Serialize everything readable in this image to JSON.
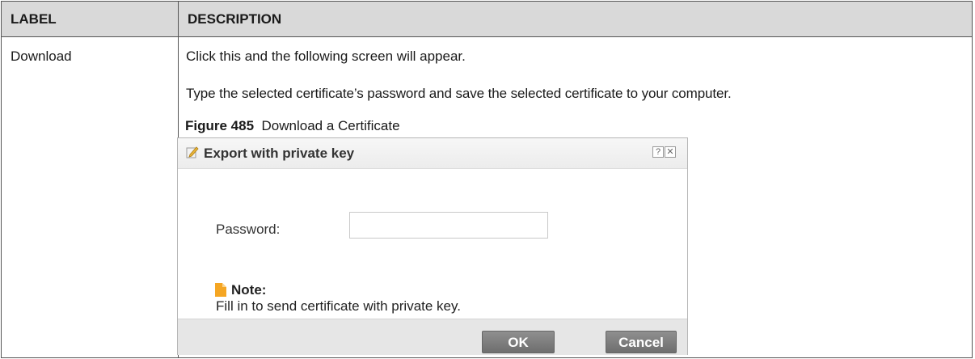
{
  "table": {
    "headers": {
      "label": "LABEL",
      "description": "DESCRIPTION"
    },
    "row": {
      "label": "Download",
      "line1": "Click this and the following screen will appear.",
      "line2": "Type the selected certificate’s password and save the selected certificate to your computer."
    }
  },
  "figure": {
    "number": "Figure 485",
    "caption": "Download a Certificate"
  },
  "dialog": {
    "title": "Export with private key",
    "help_glyph": "?",
    "close_glyph": "✕",
    "password_label": "Password:",
    "password_value": "",
    "note_title": "Note:",
    "note_text": "Fill in to send certificate with private key.",
    "ok_label": "OK",
    "cancel_label": "Cancel"
  }
}
